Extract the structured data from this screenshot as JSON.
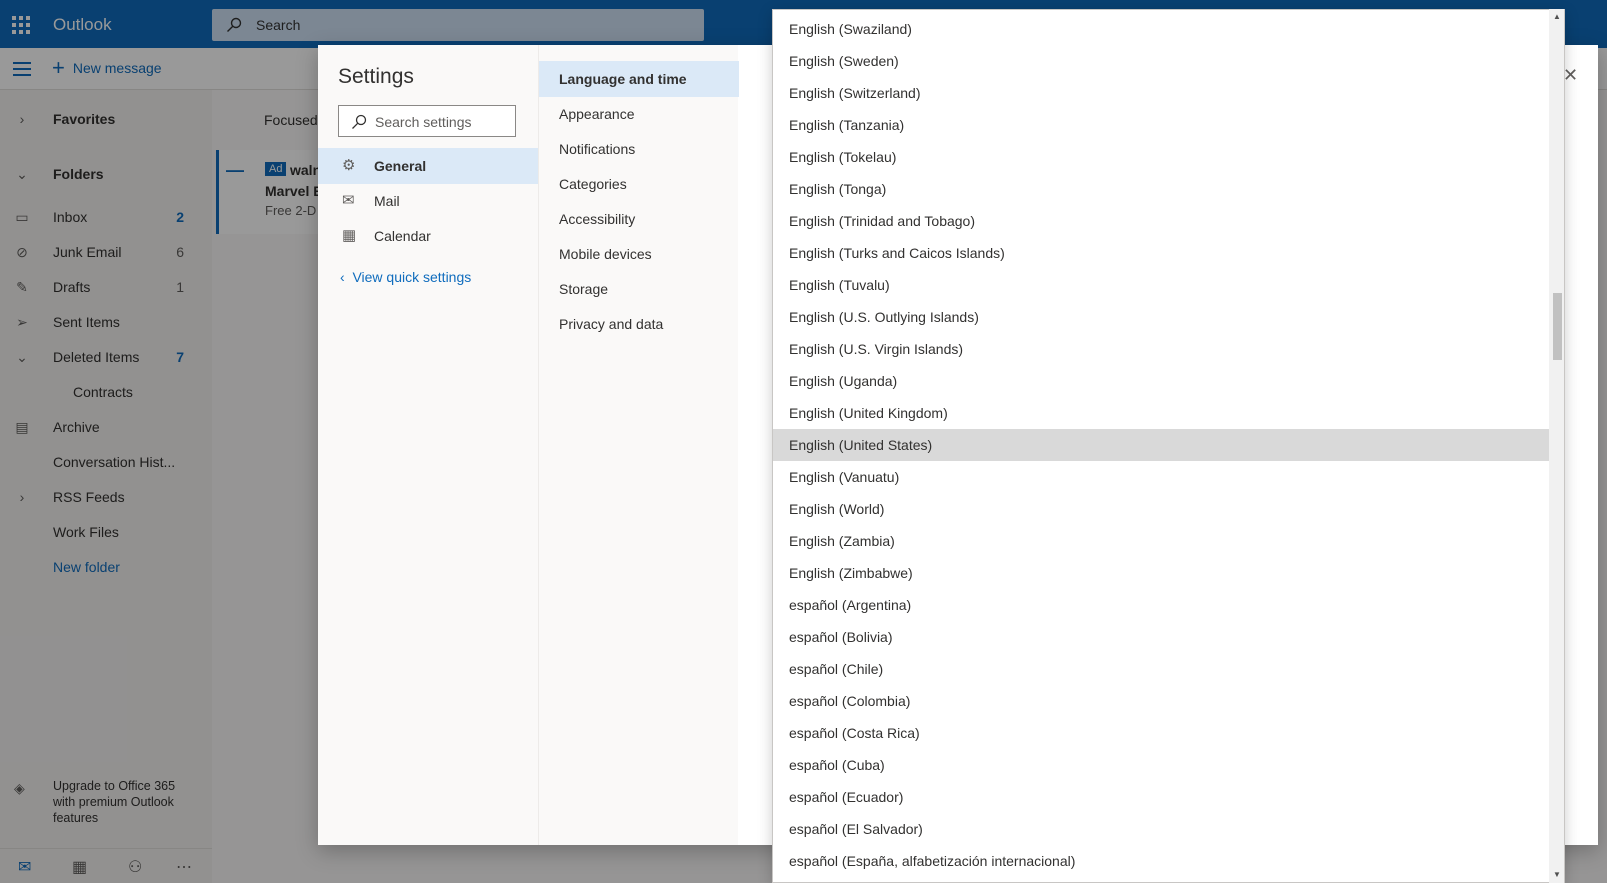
{
  "topbar": {
    "app_name": "Outlook",
    "search_placeholder": "Search"
  },
  "commandbar": {
    "new_message": "New message"
  },
  "leftnav": {
    "favorites": "Favorites",
    "folders": "Folders",
    "items": [
      {
        "label": "Inbox",
        "count": "2"
      },
      {
        "label": "Junk Email",
        "count": "6"
      },
      {
        "label": "Drafts",
        "count": "1"
      },
      {
        "label": "Sent Items",
        "count": ""
      },
      {
        "label": "Deleted Items",
        "count": "7"
      },
      {
        "label": "Contracts",
        "count": ""
      },
      {
        "label": "Archive",
        "count": ""
      },
      {
        "label": "Conversation Hist...",
        "count": ""
      },
      {
        "label": "RSS Feeds",
        "count": ""
      },
      {
        "label": "Work Files",
        "count": ""
      },
      {
        "label": "New folder",
        "count": ""
      }
    ],
    "upgrade": "Upgrade to Office 365 with premium Outlook features"
  },
  "messagelist": {
    "focused_tab": "Focused",
    "ad_tag": "Ad",
    "ad_from": "waln",
    "ad_subject": "Marvel E",
    "ad_preview": "Free 2-D"
  },
  "settings": {
    "title": "Settings",
    "search_placeholder": "Search settings",
    "categories": [
      {
        "label": "General",
        "icon": "gear-icon",
        "selected": true
      },
      {
        "label": "Mail",
        "icon": "mail-icon",
        "selected": false
      },
      {
        "label": "Calendar",
        "icon": "calendar-icon",
        "selected": false
      }
    ],
    "quick_settings": "View quick settings",
    "subcategories": [
      {
        "label": "Language and time",
        "selected": true
      },
      {
        "label": "Appearance",
        "selected": false
      },
      {
        "label": "Notifications",
        "selected": false
      },
      {
        "label": "Categories",
        "selected": false
      },
      {
        "label": "Accessibility",
        "selected": false
      },
      {
        "label": "Mobile devices",
        "selected": false
      },
      {
        "label": "Storage",
        "selected": false
      },
      {
        "label": "Privacy and data",
        "selected": false
      }
    ]
  },
  "language_dropdown": {
    "selected": "English (United States)",
    "options": [
      "English (Swaziland)",
      "English (Sweden)",
      "English (Switzerland)",
      "English (Tanzania)",
      "English (Tokelau)",
      "English (Tonga)",
      "English (Trinidad and Tobago)",
      "English (Turks and Caicos Islands)",
      "English (Tuvalu)",
      "English (U.S. Outlying Islands)",
      "English (U.S. Virgin Islands)",
      "English (Uganda)",
      "English (United Kingdom)",
      "English (United States)",
      "English (Vanuatu)",
      "English (World)",
      "English (Zambia)",
      "English (Zimbabwe)",
      "español (Argentina)",
      "español (Bolivia)",
      "español (Chile)",
      "español (Colombia)",
      "español (Costa Rica)",
      "español (Cuba)",
      "español (Ecuador)",
      "español (El Salvador)",
      "español (España, alfabetización internacional)"
    ]
  }
}
